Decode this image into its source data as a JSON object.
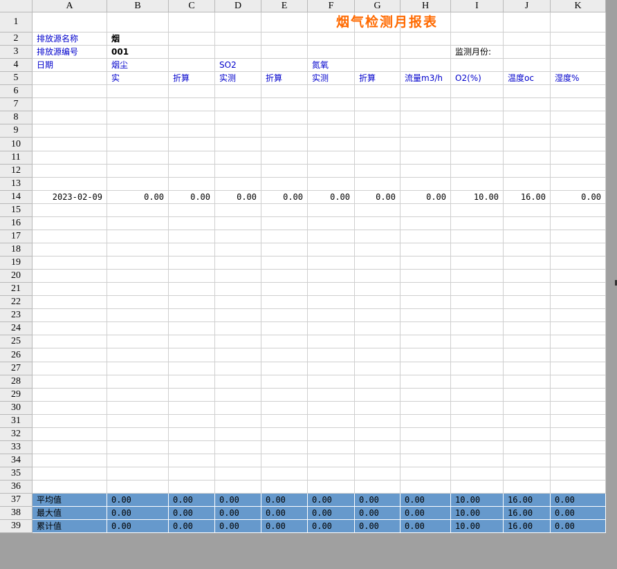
{
  "columns": [
    "A",
    "B",
    "C",
    "D",
    "E",
    "F",
    "G",
    "H",
    "I",
    "J",
    "K"
  ],
  "row_count": 39,
  "title": "烟气检测月报表",
  "info": {
    "source_name_label": "排放源名称",
    "source_name_value": "烟",
    "source_code_label": "排放源编号",
    "source_code_value": "001",
    "month_label": "监测月份:",
    "month_value": ""
  },
  "headers_row4": {
    "A": "日期",
    "B": "烟尘",
    "D": "SO2",
    "F": "氮氧"
  },
  "headers_row5": {
    "B": "实",
    "C": "折算",
    "D": "实测",
    "E": "折算",
    "F": "实测",
    "G": "折算",
    "H": "流量m3/h",
    "I": "O2(%)",
    "J": "温度oc",
    "K": "湿度%"
  },
  "data_rows": [
    {
      "row": 14,
      "date": "2023-02-09",
      "values": [
        "0.00",
        "0.00",
        "0.00",
        "0.00",
        "0.00",
        "0.00",
        "0.00",
        "10.00",
        "16.00",
        "0.00"
      ]
    }
  ],
  "summary_rows": [
    {
      "row": 37,
      "label": "平均值",
      "values": [
        "0.00",
        "0.00",
        "0.00",
        "0.00",
        "0.00",
        "0.00",
        "0.00",
        "10.00",
        "16.00",
        "0.00"
      ]
    },
    {
      "row": 38,
      "label": "最大值",
      "values": [
        "0.00",
        "0.00",
        "0.00",
        "0.00",
        "0.00",
        "0.00",
        "0.00",
        "10.00",
        "16.00",
        "0.00"
      ]
    },
    {
      "row": 39,
      "label": "累计值",
      "values": [
        "0.00",
        "0.00",
        "0.00",
        "0.00",
        "0.00",
        "0.00",
        "0.00",
        "10.00",
        "16.00",
        "0.00"
      ]
    }
  ],
  "colors": {
    "title": "#ff6a00",
    "label_blue": "#0000cc",
    "summary_bg": "#6699cc",
    "header_bg": "#ececec",
    "workspace_bg": "#a0a0a0"
  }
}
